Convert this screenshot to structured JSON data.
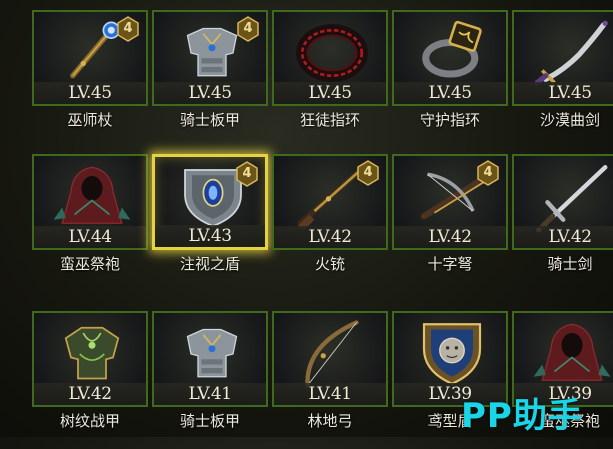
{
  "inventory": {
    "items": [
      {
        "name": "巫师杖",
        "level": "LV.45",
        "badge": "4",
        "icon": "wizard-staff-icon"
      },
      {
        "name": "骑士板甲",
        "level": "LV.45",
        "badge": "4",
        "icon": "knight-plate-armor-icon"
      },
      {
        "name": "狂徒指环",
        "level": "LV.45",
        "badge": "",
        "icon": "red-ring-icon"
      },
      {
        "name": "守护指环",
        "level": "LV.45",
        "badge": "",
        "icon": "gold-ring-icon"
      },
      {
        "name": "沙漠曲剑",
        "level": "LV.45",
        "badge": "",
        "icon": "scimitar-icon"
      },
      {
        "name": "蛮巫祭袍",
        "level": "LV.44",
        "badge": "",
        "icon": "hooded-robe-icon"
      },
      {
        "name": "注视之盾",
        "level": "LV.43",
        "badge": "4",
        "icon": "eye-shield-icon",
        "selected": true
      },
      {
        "name": "火铳",
        "level": "LV.42",
        "badge": "4",
        "icon": "musket-icon"
      },
      {
        "name": "十字弩",
        "level": "LV.42",
        "badge": "4",
        "icon": "crossbow-icon"
      },
      {
        "name": "骑士剑",
        "level": "LV.42",
        "badge": "",
        "icon": "longsword-icon"
      },
      {
        "name": "树纹战甲",
        "level": "LV.42",
        "badge": "",
        "icon": "green-armor-icon"
      },
      {
        "name": "骑士板甲",
        "level": "LV.41",
        "badge": "",
        "icon": "knight-plate-armor-icon"
      },
      {
        "name": "林地弓",
        "level": "LV.41",
        "badge": "",
        "icon": "longbow-icon"
      },
      {
        "name": "鸢型盾",
        "level": "LV.39",
        "badge": "",
        "icon": "lion-shield-icon"
      },
      {
        "name": "蛮巫祭袍",
        "level": "LV.39",
        "badge": "",
        "icon": "hooded-robe-icon"
      }
    ]
  },
  "watermark": "PP助手",
  "colors": {
    "card_border": "#3f6a1c",
    "selected_border": "#e5d240",
    "badge_fill": "#6b5418",
    "badge_stroke": "#d9b55a",
    "watermark": "#18d6e8"
  }
}
